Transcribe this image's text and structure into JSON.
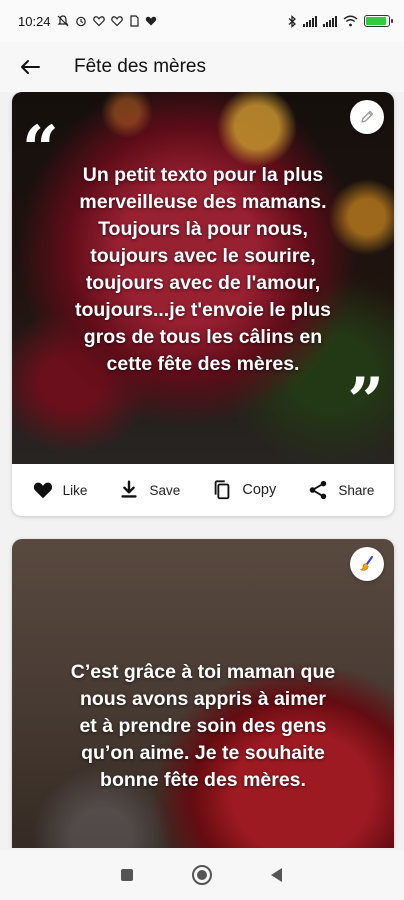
{
  "status_bar": {
    "time": "10:24",
    "left_icons": [
      "notifications-off-icon",
      "alarm-icon",
      "heart-icon",
      "heart-icon",
      "sim-icon",
      "heart-icon"
    ],
    "right_icons": [
      "bluetooth-icon",
      "signal-icon",
      "signal-icon",
      "wifi-icon",
      "battery-icon"
    ],
    "battery_level": 0.9,
    "battery_color": "#2ecc40"
  },
  "app_bar": {
    "title": "Fête des mères"
  },
  "cards": [
    {
      "quote": "Un petit texto pour la plus\nmerveilleuse des mamans.\nToujours là pour nous,\ntoujours avec le sourire,\ntoujours avec de l'amour,\ntoujours...je t'envoie le plus\ngros de tous les câlins en\ncette fête des mères.",
      "open_quote": "“",
      "close_quote": "”",
      "corner_icon": "edit-pencil-icon",
      "actions": {
        "like": "Like",
        "save": "Save",
        "copy": "Copy",
        "share": "Share"
      }
    },
    {
      "quote": "C’est grâce à toi maman que\nnous avons appris à aimer\net à prendre soin des gens\nqu’on aime. Je te souhaite\nbonne fête des mères.",
      "corner_icon": "paint-brush-icon"
    }
  ],
  "nav_bar": {
    "icons": [
      "recents-square-icon",
      "home-circle-icon",
      "back-triangle-icon"
    ]
  }
}
